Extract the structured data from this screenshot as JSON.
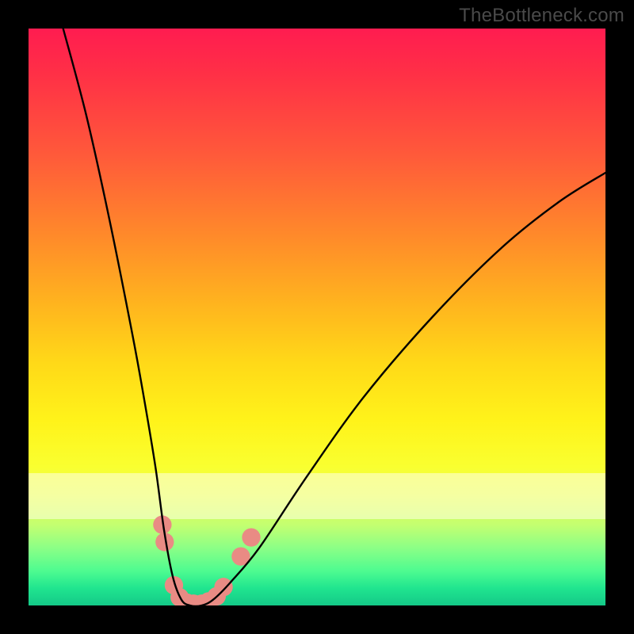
{
  "watermark": "TheBottleneck.com",
  "chart_data": {
    "type": "line",
    "title": "",
    "xlabel": "",
    "ylabel": "",
    "xlim": [
      0,
      100
    ],
    "ylim": [
      0,
      100
    ],
    "grid": false,
    "series": [
      {
        "name": "bottleneck-curve",
        "x": [
          6,
          10,
          14,
          18,
          20,
          22,
          23.5,
          25,
          26.5,
          28,
          30,
          32,
          35,
          40,
          48,
          58,
          70,
          82,
          92,
          100
        ],
        "values": [
          100,
          85,
          67,
          47,
          36,
          24,
          13,
          5,
          1,
          0,
          0,
          1,
          4,
          10,
          22,
          36,
          50,
          62,
          70,
          75
        ]
      }
    ],
    "markers": {
      "name": "highlight-dots",
      "color": "#e98b84",
      "radius_pct": 1.6,
      "points": [
        {
          "x": 23.2,
          "y": 14
        },
        {
          "x": 23.6,
          "y": 11
        },
        {
          "x": 25.2,
          "y": 3.5
        },
        {
          "x": 26.2,
          "y": 1.4
        },
        {
          "x": 27.4,
          "y": 0.5
        },
        {
          "x": 28.6,
          "y": 0.3
        },
        {
          "x": 30.0,
          "y": 0.3
        },
        {
          "x": 31.2,
          "y": 0.7
        },
        {
          "x": 32.6,
          "y": 1.6
        },
        {
          "x": 33.8,
          "y": 3.2
        },
        {
          "x": 36.8,
          "y": 8.5
        },
        {
          "x": 38.6,
          "y": 11.8
        }
      ]
    },
    "background_gradient": {
      "top": "#ff1c50",
      "mid": "#fff31a",
      "bottom": "#14c988"
    }
  }
}
